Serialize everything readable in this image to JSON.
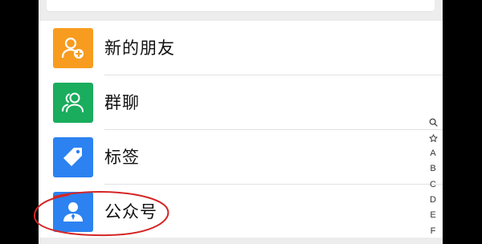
{
  "colors": {
    "new_friends": "#f79c1f",
    "group_chats": "#1aad5e",
    "tags": "#2c82f0",
    "official_accounts": "#2c82f0",
    "annotation": "#d42626"
  },
  "contacts_menu": {
    "items": [
      {
        "label": "新的朋友",
        "icon": "add-friend-icon"
      },
      {
        "label": "群聊",
        "icon": "group-chat-icon"
      },
      {
        "label": "标签",
        "icon": "tag-icon"
      },
      {
        "label": "公众号",
        "icon": "official-account-icon"
      }
    ]
  },
  "index_bar": {
    "items": [
      "search-icon",
      "star-icon",
      "A",
      "B",
      "C",
      "D",
      "E",
      "F"
    ]
  }
}
